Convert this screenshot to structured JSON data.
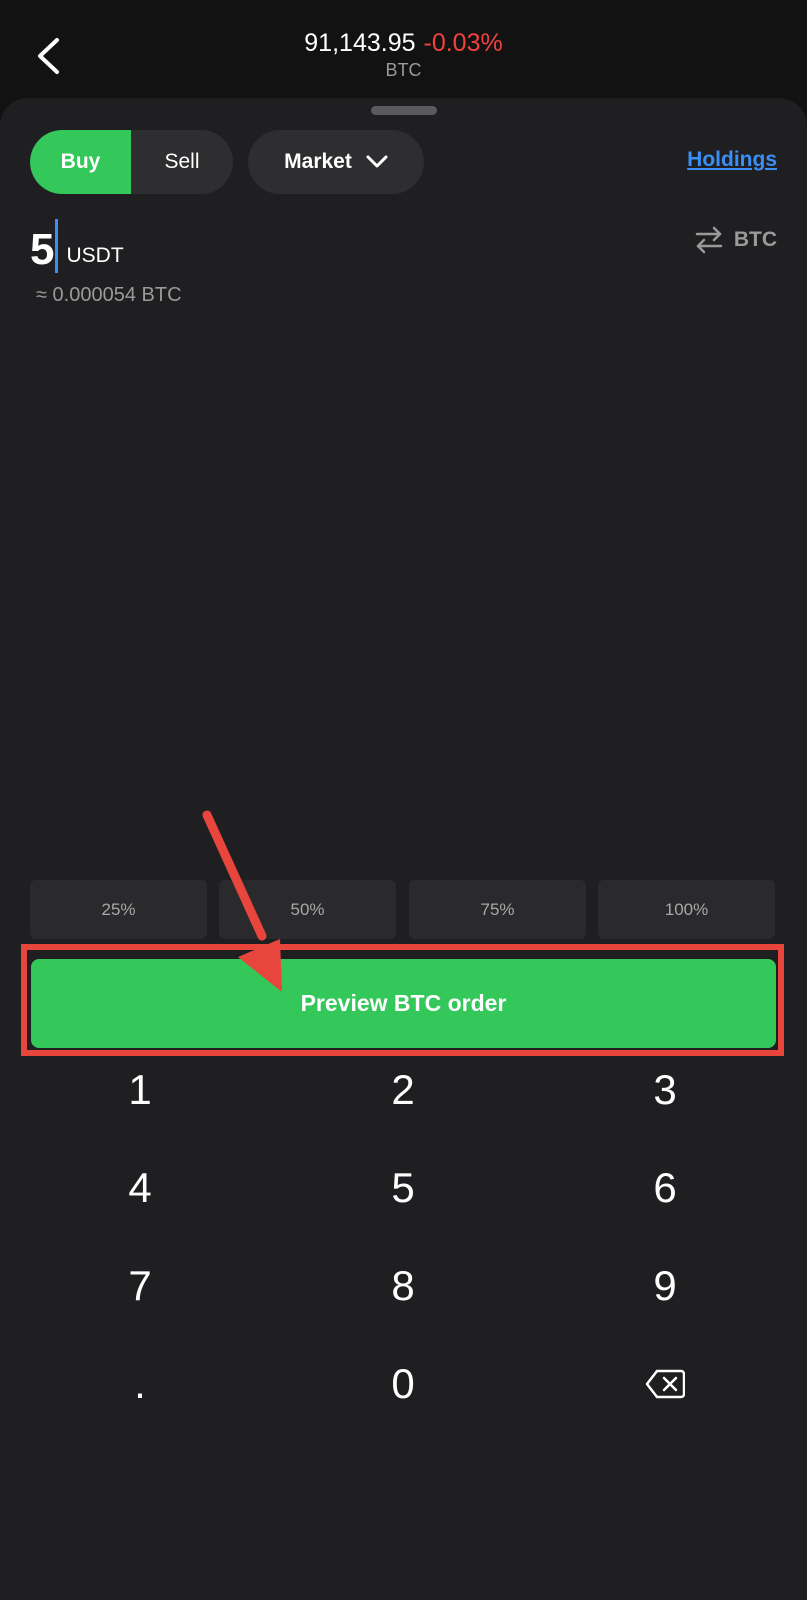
{
  "header": {
    "price": "91,143.95",
    "change": "-0.03%",
    "symbol": "BTC",
    "change_color": "#f0423c"
  },
  "trade": {
    "buy_label": "Buy",
    "sell_label": "Sell",
    "selected_side": "Buy",
    "order_type": "Market",
    "holdings_label": "Holdings",
    "amount": "5",
    "amount_unit": "USDT",
    "swap_unit": "BTC",
    "approx": "≈ 0.000054 BTC"
  },
  "percent_options": [
    "25%",
    "50%",
    "75%",
    "100%"
  ],
  "preview_button": "Preview BTC order",
  "keypad": {
    "keys": [
      "1",
      "2",
      "3",
      "4",
      "5",
      "6",
      "7",
      "8",
      "9",
      ".",
      "0"
    ],
    "backspace_icon": "backspace-icon"
  },
  "colors": {
    "accent_green": "#34c759",
    "link_blue": "#3a8ef6",
    "annotation_red": "#e8453c",
    "negative_red": "#f0423c"
  },
  "icons": {
    "back": "chevron-left-icon",
    "dropdown": "chevron-down-icon",
    "swap": "swap-arrows-icon",
    "backspace": "backspace-icon"
  }
}
